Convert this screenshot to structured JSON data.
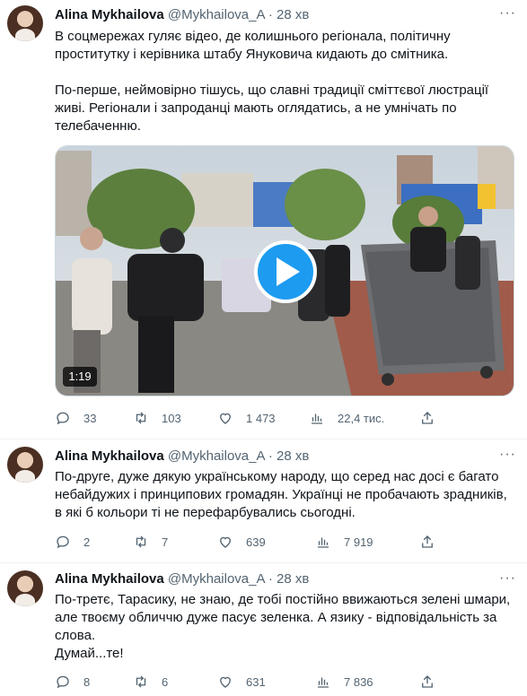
{
  "tweets": [
    {
      "author": "Alina Mykhailova",
      "handle": "@Mykhailova_A",
      "dot": "·",
      "time": "28 хв",
      "paragraphs": [
        "В соцмережах гуляє відео, де колишнього регіонала, політичну проститутку і керівника штабу Януковича кидають до смітника.",
        "По-перше, неймовірно тішусь, що славні традиції сміттєвої люстрації живі. Регіонали і запроданці мають оглядатись, а не умнічать по телебаченню."
      ],
      "video": {
        "duration": "1:19",
        "play_icon": "play-icon"
      },
      "stats": {
        "replies": "33",
        "retweets": "103",
        "likes": "1 473",
        "views": "22,4 тис."
      }
    },
    {
      "author": "Alina Mykhailova",
      "handle": "@Mykhailova_A",
      "dot": "·",
      "time": "28 хв",
      "paragraphs": [
        "По-друге, дуже дякую українському народу, що серед нас досі є багато небайдужих і принципових громадян. Українці не пробачають зрадників, в які б кольори ті не перефарбувались сьогодні."
      ],
      "stats": {
        "replies": "2",
        "retweets": "7",
        "likes": "639",
        "views": "7 919"
      }
    },
    {
      "author": "Alina Mykhailova",
      "handle": "@Mykhailova_A",
      "dot": "·",
      "time": "28 хв",
      "paragraphs": [
        "По-третє, Тарасику, не знаю, де тобі постійно ввижаються зелені шмари, але твоєму обличчю дуже пасує зеленка. А язику - відповідальність за слова.",
        "Думай...те!"
      ],
      "stats": {
        "replies": "8",
        "retweets": "6",
        "likes": "631",
        "views": "7 836"
      }
    }
  ],
  "icons": {
    "more": "more-icon",
    "reply": "reply-icon",
    "retweet": "retweet-icon",
    "like": "heart-icon",
    "views": "views-icon",
    "share": "share-icon"
  },
  "colors": {
    "text": "#0f1419",
    "muted": "#536471",
    "accent": "#1d9bf0",
    "divider": "#eff3f4"
  }
}
